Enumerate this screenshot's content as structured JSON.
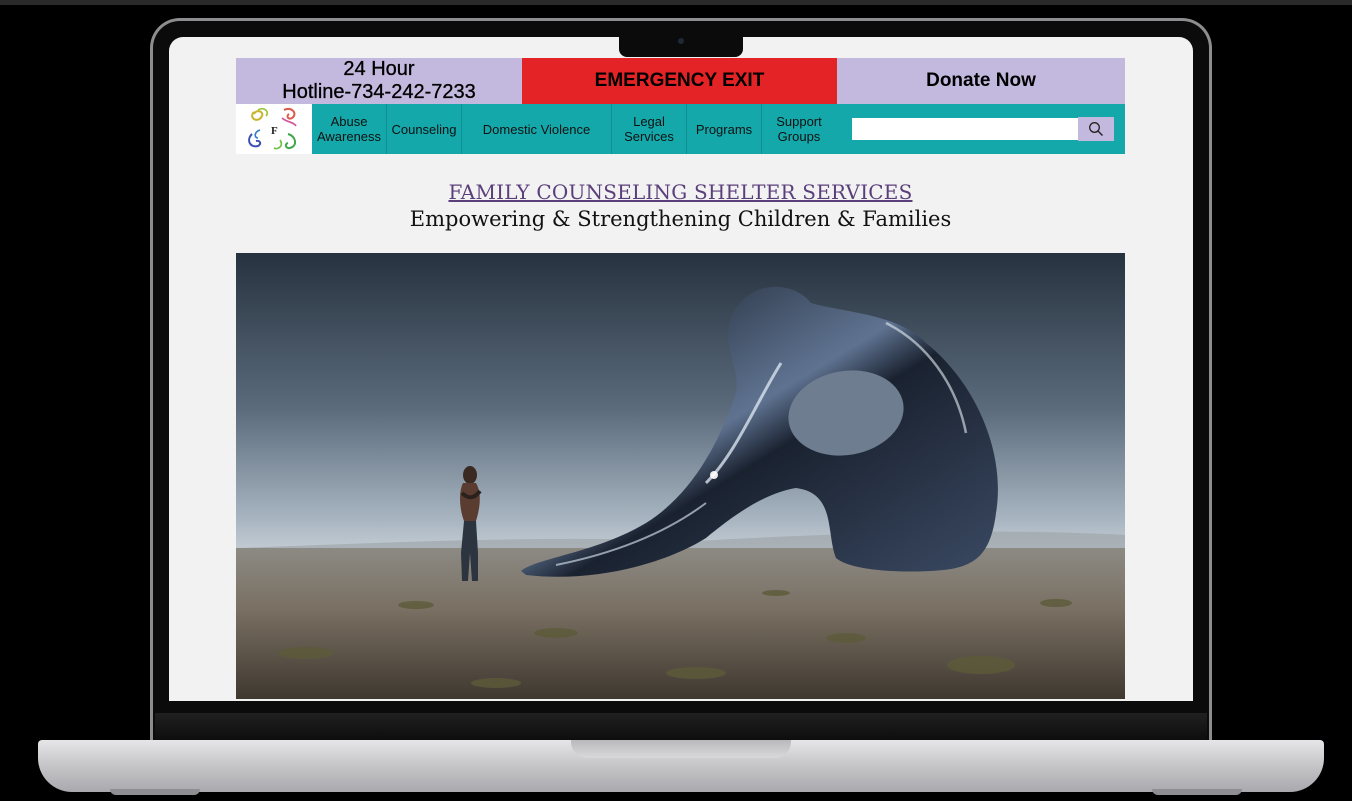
{
  "topbar": {
    "hotline_line1": "24 Hour",
    "hotline_line2": "Hotline-734-242-7233",
    "emergency_label": "EMERGENCY EXIT",
    "donate_label": "Donate Now"
  },
  "logo": {
    "letter": "F"
  },
  "nav": {
    "items": [
      {
        "label": "Abuse Awareness"
      },
      {
        "label": "Counseling"
      },
      {
        "label": "Domestic Violence"
      },
      {
        "label": "Legal Services"
      },
      {
        "label": "Programs"
      },
      {
        "label": "Support Groups"
      }
    ],
    "search_placeholder": "",
    "search_icon": "search-icon"
  },
  "main": {
    "title": "FAMILY COUNSELING SHELTER SERVICES",
    "subtitle": "Empowering & Strengthening Children & Families"
  },
  "colors": {
    "lavender": "#c3b8dd",
    "emergency_red": "#e42326",
    "nav_teal": "#14a8aa",
    "title_purple": "#5b3f7a"
  }
}
